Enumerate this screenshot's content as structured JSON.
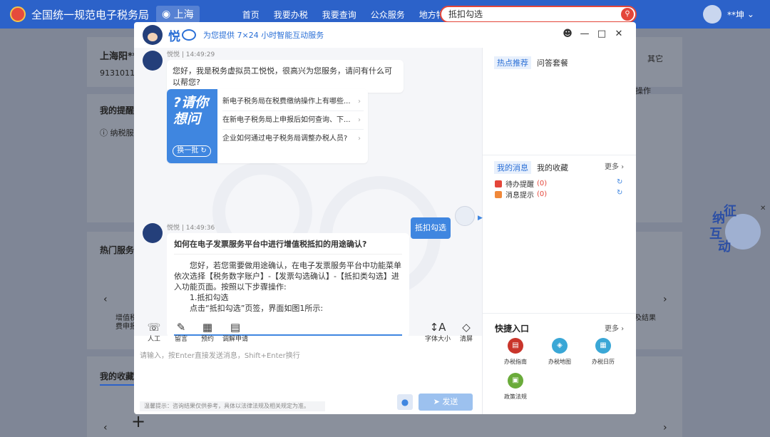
{
  "site": {
    "title": "全国统一规范电子税务局",
    "region": "上海",
    "nav": [
      "首页",
      "我要办税",
      "我要查询",
      "公众服务",
      "地方特色"
    ],
    "search_value": "抵扣勾选",
    "user": "**坤"
  },
  "background": {
    "company_name": "上海阳**",
    "company_id": "91310113",
    "other": "其它",
    "ops": "操作",
    "reminders": "我的提醒",
    "taxpayer": "纳税服",
    "hot_services": "热门服务",
    "svc_left_1": "增值税",
    "svc_left_2": "费申报",
    "svc_right": "及结果",
    "my_favorites": "我的收藏",
    "floater_chars": [
      "征",
      "纳",
      "互",
      "动"
    ]
  },
  "dialog": {
    "brand": "悦",
    "tagline": "为您提供 7×24 小时智能互动服务",
    "chat": {
      "meta1": "悦悦 | 14:49:29",
      "greeting": "您好，我是税务虚拟员工悦悦，很高兴为您服务，请问有什么可以帮您?",
      "ask_banner_line1": "?请你",
      "ask_banner_line2": "想问",
      "swap_label": "换一批",
      "ask_items": [
        "新电子税务局在税费缴纳操作上有哪些...",
        "在新电子税务局上申报后如何查询、下...",
        "企业如何通过电子税务局调整办税人员?"
      ],
      "user_message": "抵扣勾选",
      "meta2": "悦悦 | 14:49:36",
      "answer_title": "如何在电子发票服务平台中进行增值税抵扣的用途确认?",
      "answer_body": "您好，若您需要做用途确认，在电子发票服务平台中功能菜单依次选择【税务数字账户】-【发票勾选确认】-【抵扣类勾选】进入功能页面。按照以下步骤操作:",
      "answer_step": "1.抵扣勾选",
      "answer_step_detail": "点击“抵扣勾选”页签，界面如图1所示:"
    },
    "toolbar": {
      "left": [
        {
          "label": "人工",
          "icon": "headset-icon"
        },
        {
          "label": "留言",
          "icon": "edit-icon"
        },
        {
          "label": "预约",
          "icon": "calendar-icon"
        },
        {
          "label": "调解申请",
          "icon": "document-icon"
        }
      ],
      "right": [
        {
          "label": "字体大小",
          "icon": "font-size-icon"
        },
        {
          "label": "清屏",
          "icon": "eraser-icon"
        }
      ]
    },
    "input_placeholder": "请输入，按Enter直接发送消息，Shift+Enter换行",
    "notice": "温馨提示：咨询结果仅供参考，具体以法律法规及相关规定为准。",
    "send_label": "发送",
    "right": {
      "hot_tab": "热点推荐",
      "qa_tab": "问答套餐",
      "msg_tab": "我的消息",
      "fav_tab": "我的收藏",
      "more": "更多",
      "todo_label": "待办提醒",
      "todo_count": "(0)",
      "notice_label": "消息提示",
      "notice_count": "(0)",
      "quick_title": "快捷入口",
      "quick_more": "更多",
      "quick": [
        {
          "label": "办税指南",
          "color": "#c9352b"
        },
        {
          "label": "办税地图",
          "color": "#3aa7d6"
        },
        {
          "label": "办税日历",
          "color": "#3aa7d6"
        },
        {
          "label": "政策法规",
          "color": "#6aab3a"
        }
      ]
    }
  }
}
